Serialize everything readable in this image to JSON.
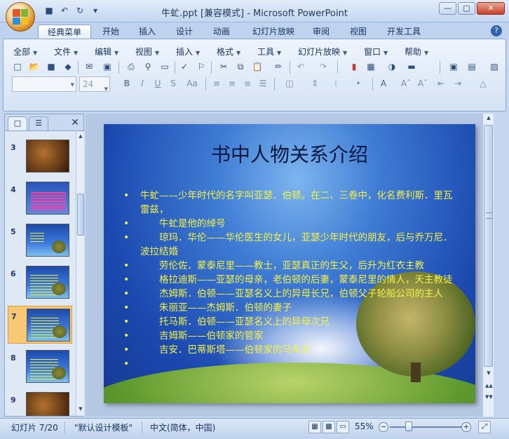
{
  "window": {
    "title": "牛虻.ppt [兼容模式] - Microsoft PowerPoint",
    "controls": {
      "minimize": "—",
      "maximize": "▢",
      "close": "✕"
    }
  },
  "quick_access": [
    "save-icon",
    "undo-icon",
    "redo-icon",
    "customize-icon"
  ],
  "ribbon_tabs": [
    "经典菜单",
    "开始",
    "插入",
    "设计",
    "动画",
    "幻灯片放映",
    "审阅",
    "视图",
    "开发工具"
  ],
  "active_tab": "经典菜单",
  "help_label": "?",
  "menus": [
    "全部",
    "文件",
    "编辑",
    "视图",
    "插入",
    "格式",
    "工具",
    "幻灯片放映",
    "窗口",
    "帮助"
  ],
  "format": {
    "font_name": "",
    "font_size": "24"
  },
  "thumbnails": {
    "numbers": [
      "3",
      "4",
      "5",
      "6",
      "7",
      "8",
      "9"
    ],
    "selected": "7"
  },
  "slide": {
    "title": "书中人物关系介绍",
    "bullets": [
      "牛虻——少年时代的名字叫亚瑟．伯顿。在二、三卷中，化名费利斯．里瓦雷兹，",
      "　　牛虻是他的绰号",
      "　　琼玛．华伦——华伦医生的女儿，亚瑟少年时代的朋友，后与乔万尼．波拉结婚",
      "　　劳伦佐．蒙泰尼里——教士，亚瑟真正的生父，后升为红衣主教",
      "　　格拉迪斯——亚瑟的母亲，老伯顿的后妻，蒙泰尼里的情人，天主教徒",
      "　　杰姆斯．伯顿——亚瑟名义上的异母长兄，伯顿父子轮船公司的主人",
      "　　朱丽亚——杰姆斯．伯顿的妻子",
      "　　托马斯．伯顿——亚瑟名义上的异母次兄",
      "　　吉姆斯——伯顿家的管家",
      "　　吉安．巴蒂斯塔——伯顿家的马车夫",
      ""
    ]
  },
  "status": {
    "slide_info": "幻灯片 7/20",
    "theme": "\"默认设计模板\"",
    "language": "中文(简体，中国)",
    "zoom": "55%",
    "zoom_out": "−",
    "zoom_in": "+"
  }
}
